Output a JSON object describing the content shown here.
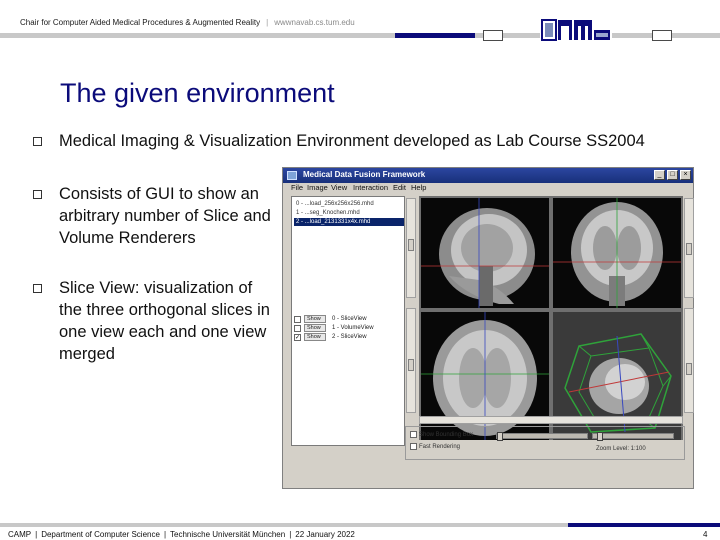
{
  "header": {
    "chair": "Chair for Computer Aided Medical Procedures & Augmented Reality",
    "separator": "|",
    "url": "wwwnavab.cs.tum.edu",
    "logo": "CAMP TUM logo"
  },
  "title": "The given environment",
  "bullets": [
    "Medical Imaging & Visualization Environment developed as Lab Course SS2004",
    "Consists of GUI to show an arbitrary number of Slice and Volume Renderers",
    "Slice View: visualization of the three orthogonal slices in one view each and one view merged"
  ],
  "app": {
    "window_title": "Medical Data Fusion Framework",
    "menu": [
      "File",
      "Image",
      "View",
      "Interaction",
      "Edit",
      "Help"
    ],
    "files": [
      {
        "label": "0 - ...load_256x256x256.mhd",
        "selected": false
      },
      {
        "label": "1 - ...seg_Knochen.mhd",
        "selected": false
      },
      {
        "label": "2 - ...load_2131331x4x.mhd",
        "selected": true
      }
    ],
    "renderers": [
      {
        "button": "Show",
        "label": "0 - SliceView"
      },
      {
        "button": "Show",
        "label": "1 - VolumeView"
      },
      {
        "button": "Show",
        "label": "2 - SliceView"
      }
    ],
    "options": [
      "Show Bounding Box",
      "Fast Rendering"
    ],
    "zoom": "Zoom Level: 1:100"
  },
  "footer": {
    "org": "CAMP",
    "dept": "Department of Computer Science",
    "uni": "Technische Universität München",
    "date": "22 January 2022",
    "page": "4"
  },
  "colors": {
    "title": "#0b0b7a",
    "header_bar_gray": "#c8c8c8",
    "header_bar_blue": "#0b0b7a",
    "window_title": "#1f3a8a"
  }
}
